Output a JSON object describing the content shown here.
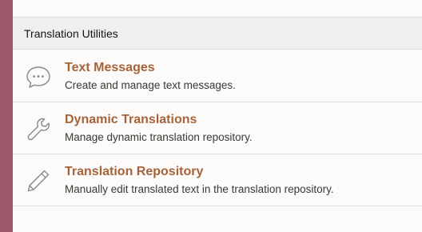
{
  "section": {
    "title": "Translation Utilities"
  },
  "items": [
    {
      "title": "Text Messages",
      "description": "Create and manage text messages.",
      "icon": "chat-bubble-icon"
    },
    {
      "title": "Dynamic Translations",
      "description": "Manage dynamic translation repository.",
      "icon": "wrench-icon"
    },
    {
      "title": "Translation Repository",
      "description": "Manually edit translated text in the translation repository.",
      "icon": "pencil-icon"
    }
  ],
  "colors": {
    "sidebar_strip": "#9c5a6c",
    "link": "#a6633a",
    "header_bg": "#f1efed"
  }
}
